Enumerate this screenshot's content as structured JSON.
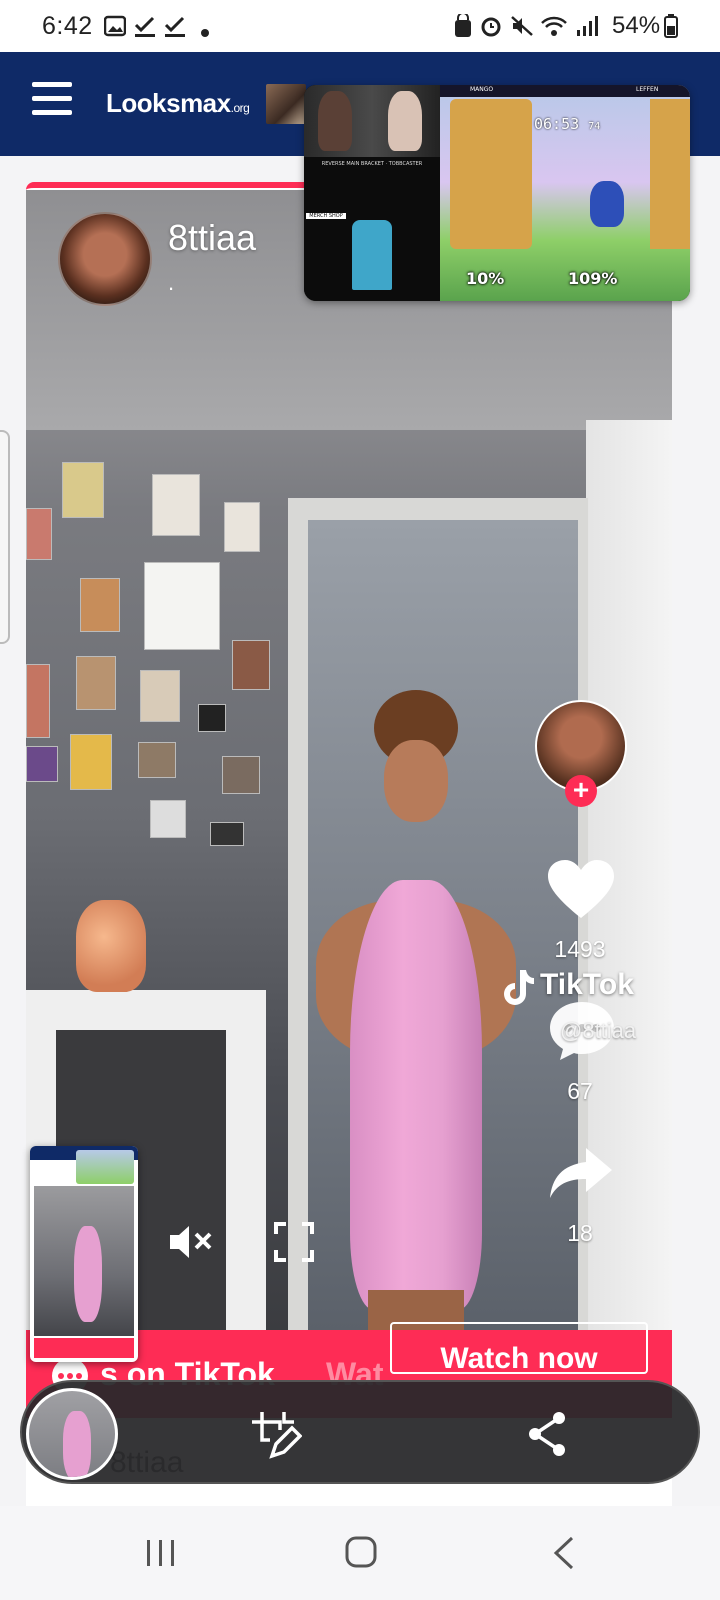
{
  "status_bar": {
    "time": "6:42",
    "battery_percent": "54%"
  },
  "header": {
    "logo_main": "Looksmax",
    "logo_suffix": ".org"
  },
  "game_overlay": {
    "cam_caption": "REVERSE MAIN BRACKET · TOBBCASTER",
    "shop_label": "MERCH SHOP",
    "timer": "06:53",
    "timer_fraction": "74",
    "p1_percent": "10%",
    "p2_percent": "109%",
    "p1_name": "MANGO",
    "p2_name": "LEFFEN"
  },
  "tiktok": {
    "username": "8ttiaa",
    "bio": ".",
    "likes": "1493",
    "comments": "67",
    "shares": "18",
    "watermark": "TikTok",
    "watermark_user": "@8ttiaa",
    "banner_text": "s on TikTok",
    "banner_faint": "Wat",
    "watch_button": "Watch now",
    "below_name": "8ttiaa"
  },
  "colors": {
    "header_bg": "#0f2a67",
    "tiktok_red": "#fe2c55"
  },
  "icons": {
    "mute": "speaker-mute-icon",
    "fullscreen": "fullscreen-icon",
    "share": "share-icon",
    "edit": "crop-edit-icon"
  }
}
